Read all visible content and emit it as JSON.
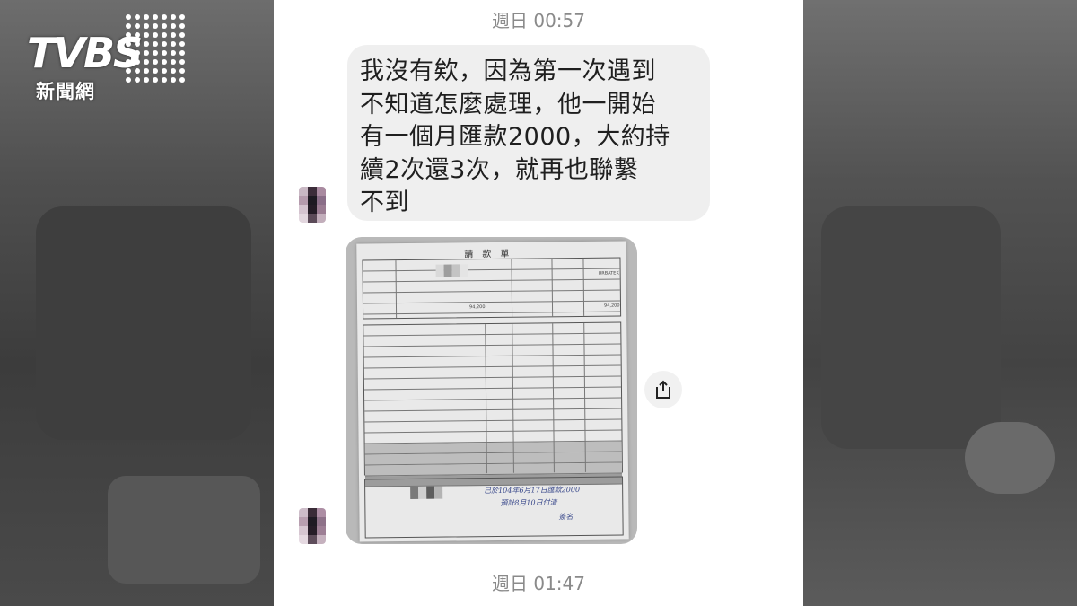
{
  "logo": {
    "brand": "TVBS",
    "sub": "新聞網"
  },
  "chat": {
    "timestamp_top": "週日 00:57",
    "timestamp_bottom": "週日 01:47",
    "message": {
      "lines": [
        "我沒有欸，因為第一次遇到",
        "不知道怎麼處理，他一開始",
        "有一個月匯款2000，大約持",
        "續2次還3次，就再也聯繫",
        "不到"
      ]
    },
    "photo": {
      "doc_title": "請款單",
      "amount_1": "94,200",
      "amount_2": "94,200",
      "brand_field": "URBATEK",
      "handwriting_1": "已於104年6月17日匯款2000",
      "handwriting_2": "預計8月10日付清",
      "handwriting_sign": "簽名"
    }
  },
  "icons": {
    "share": "share-icon"
  },
  "colors": {
    "bubble": "#efefef",
    "timestamp": "#8a8a8a",
    "text": "#1f1f1f"
  }
}
